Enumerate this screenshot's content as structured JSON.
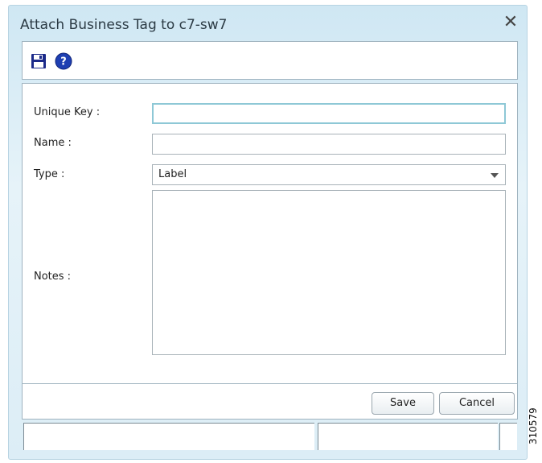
{
  "dialog": {
    "title": "Attach Business Tag to c7-sw7",
    "close_glyph": "✕"
  },
  "toolbar": {
    "icons": [
      "save-icon",
      "help-icon"
    ],
    "help_glyph": "?"
  },
  "form": {
    "unique_key_label": "Unique Key :",
    "unique_key_value": "",
    "name_label": "Name :",
    "name_value": "",
    "type_label": "Type :",
    "type_selected": "Label",
    "notes_label": "Notes :",
    "notes_value": ""
  },
  "buttons": {
    "save_label": "Save",
    "cancel_label": "Cancel"
  },
  "figure_id": "310579",
  "colors": {
    "accent": "#1e3fb2",
    "focus": "#8ec8d6",
    "save_icon": "#1c2a8a"
  }
}
